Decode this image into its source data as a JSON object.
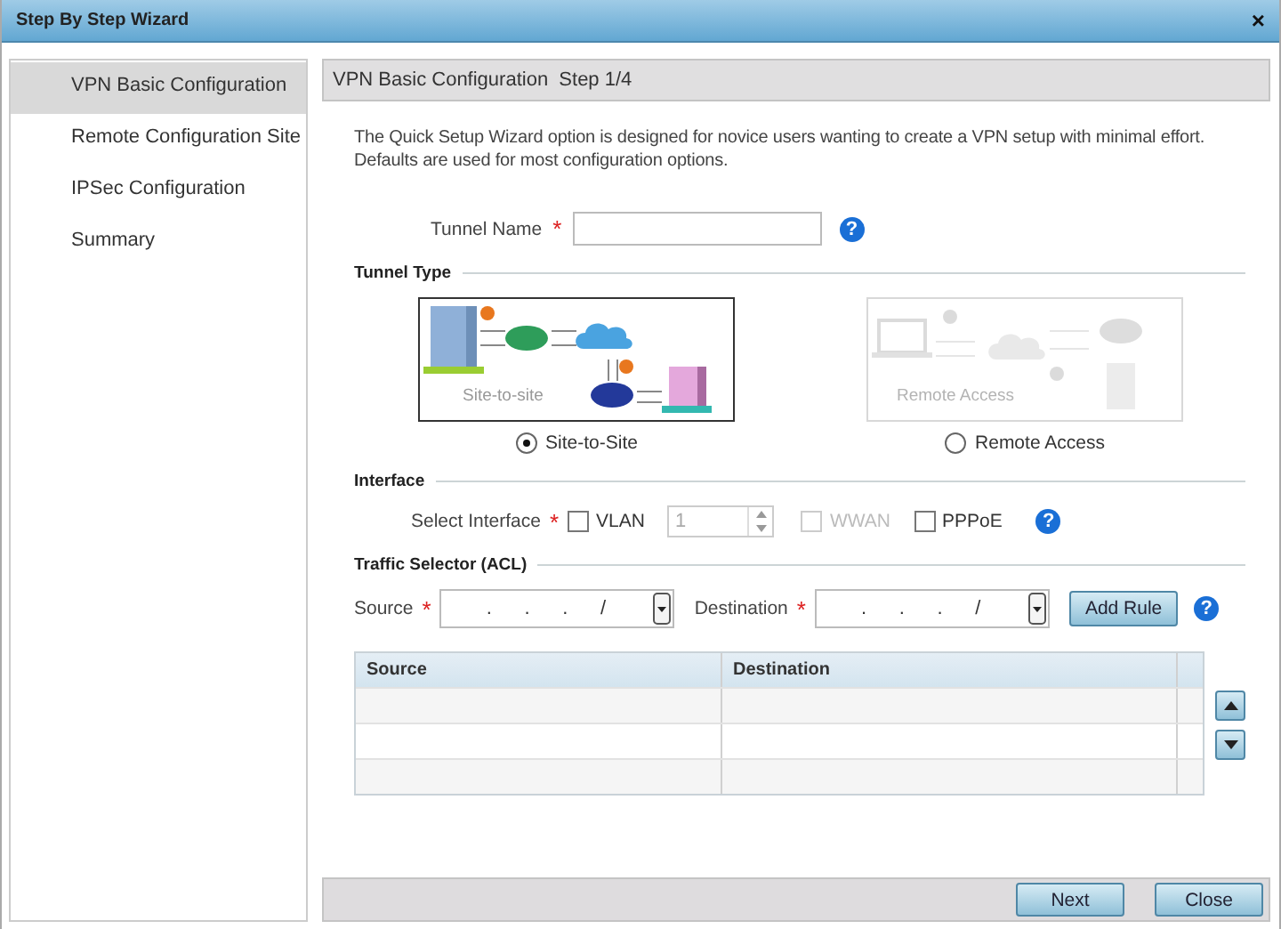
{
  "window": {
    "title": "Step By Step Wizard",
    "close": "×"
  },
  "sidebar": {
    "items": [
      {
        "label": "VPN Basic Configuration",
        "selected": true
      },
      {
        "label": "Remote Configuration Site",
        "selected": false
      },
      {
        "label": "IPSec Configuration",
        "selected": false
      },
      {
        "label": "Summary",
        "selected": false
      }
    ]
  },
  "step_header": "VPN Basic Configuration  Step 1/4",
  "intro_lines": [
    "The Quick Setup Wizard option is designed for novice users wanting to create a VPN setup with minimal effort.",
    "Defaults are used for most configuration options."
  ],
  "tunnel_name": {
    "label": "Tunnel Name",
    "required": "*",
    "help": "?"
  },
  "tunnel_type": {
    "heading": "Tunnel Type",
    "options": [
      {
        "kind": "site",
        "caption": "Site-to-site",
        "label": "Site-to-Site",
        "selected": true
      },
      {
        "kind": "remote",
        "caption": "Remote Access",
        "label": "Remote Access",
        "selected": false
      }
    ]
  },
  "interface": {
    "heading": "Interface",
    "label": "Select Interface",
    "required": "*",
    "help": "?",
    "options": [
      {
        "kind": "checkbox",
        "label": "VLAN",
        "checked": false,
        "disabled": false
      },
      {
        "kind": "spinner",
        "value": "1",
        "disabled": true
      },
      {
        "kind": "checkbox",
        "label": "WWAN",
        "checked": false,
        "disabled": true
      },
      {
        "kind": "checkbox",
        "label": "PPPoE",
        "checked": false,
        "disabled": false
      }
    ]
  },
  "traffic_selector": {
    "heading": "Traffic Selector (ACL)",
    "source": {
      "label": "Source",
      "required": "*",
      "value": ".      .      .      /"
    },
    "destination": {
      "label": "Destination",
      "required": "*",
      "value": ".      .      .      /"
    },
    "add_rule": "Add Rule",
    "help": "?"
  },
  "table": {
    "columns": [
      "Source",
      "Destination"
    ]
  },
  "buttons": [
    {
      "label": "Next"
    },
    {
      "label": "Close"
    }
  ]
}
